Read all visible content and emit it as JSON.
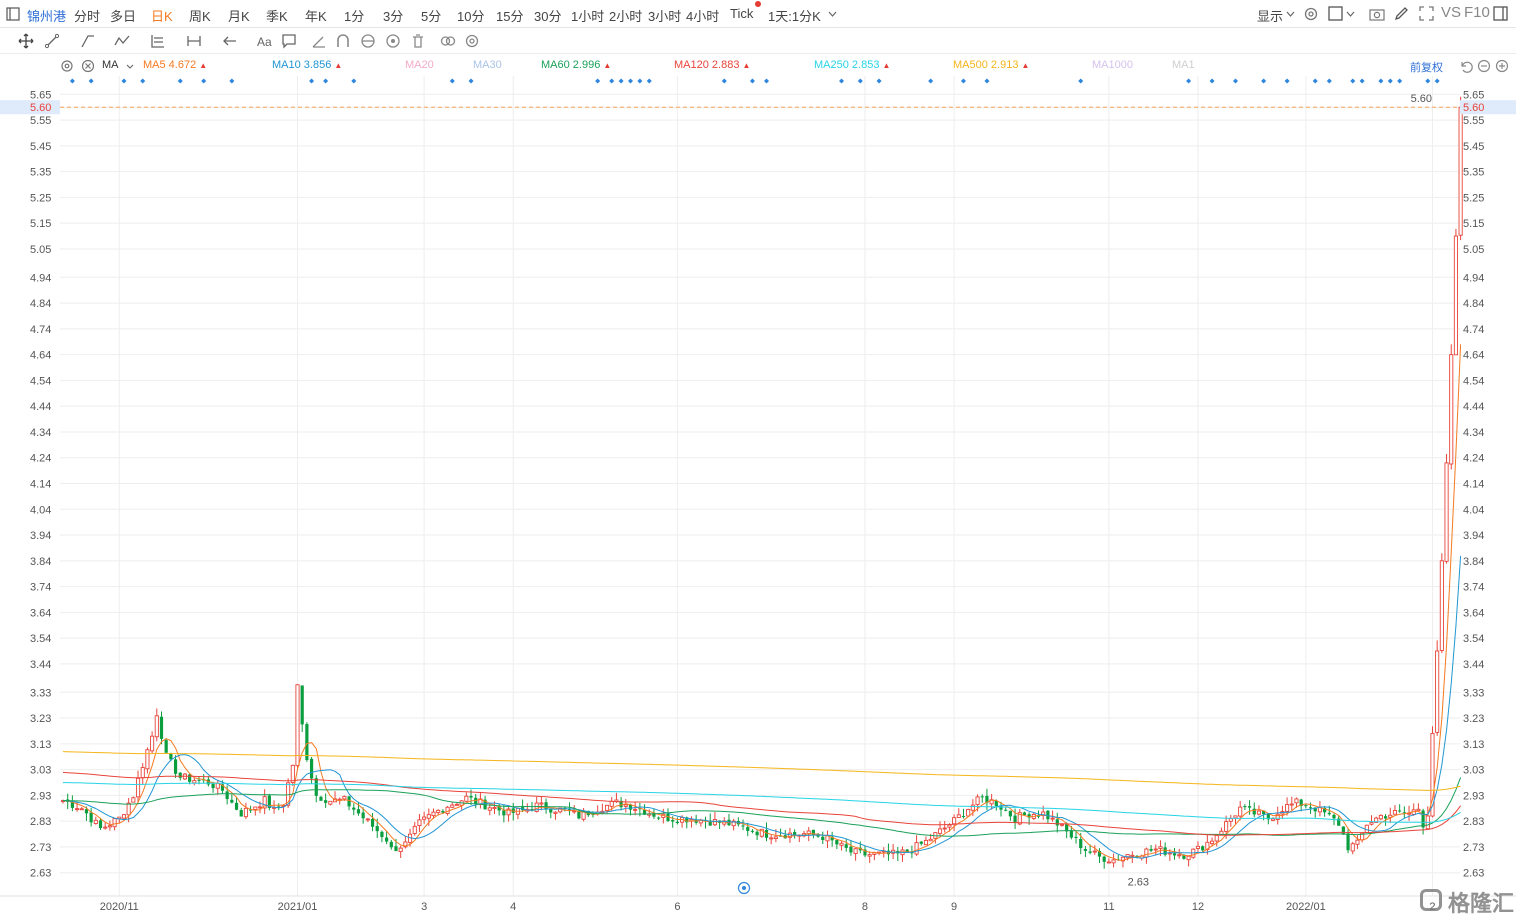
{
  "topbar": {
    "ticker": "锦州港",
    "periods": [
      "分时",
      "多日",
      "日K",
      "周K",
      "月K",
      "季K",
      "年K",
      "1分",
      "3分",
      "5分",
      "10分",
      "15分",
      "30分",
      "1小时",
      "2小时",
      "3小时",
      "4小时",
      "Tick"
    ],
    "active_period": "日K",
    "combo": "1天:1分K",
    "display_label": "显示",
    "vs_label": "VS",
    "f10_label": "F10"
  },
  "indicators": {
    "group_label": "MA",
    "items": [
      {
        "name": "MA5",
        "value": "4.672",
        "color": "#f57a20",
        "faded": false,
        "arrow": true
      },
      {
        "name": "MA10",
        "value": "3.856",
        "color": "#2196d3",
        "faded": false,
        "arrow": true
      },
      {
        "name": "MA20",
        "value": "",
        "color": "#f4aac8",
        "faded": true,
        "arrow": false
      },
      {
        "name": "MA30",
        "value": "",
        "color": "#a9c3e6",
        "faded": true,
        "arrow": false
      },
      {
        "name": "MA60",
        "value": "2.996",
        "color": "#1aa15a",
        "faded": false,
        "arrow": true
      },
      {
        "name": "MA120",
        "value": "2.883",
        "color": "#e8443a",
        "faded": false,
        "arrow": true
      },
      {
        "name": "MA250",
        "value": "2.853",
        "color": "#27d3e6",
        "faded": false,
        "arrow": true
      },
      {
        "name": "MA500",
        "value": "2.913",
        "color": "#f5b51a",
        "faded": false,
        "arrow": true
      },
      {
        "name": "MA1000",
        "value": "",
        "color": "#d4c2ee",
        "faded": true,
        "arrow": false
      },
      {
        "name": "MA1",
        "value": "",
        "color": "#cfcfcf",
        "faded": true,
        "arrow": false
      }
    ],
    "adjust_label": "前复权"
  },
  "colors": {
    "up": "#e8443a",
    "down": "#0b9e3f",
    "grid": "#eeeeee",
    "current_price": "#f5a35a"
  },
  "chart_data": {
    "type": "candlestick",
    "price_ticks": [
      "5.65",
      "5.60",
      "5.55",
      "5.45",
      "5.35",
      "5.25",
      "5.15",
      "5.05",
      "4.94",
      "4.84",
      "4.74",
      "4.64",
      "4.54",
      "4.44",
      "4.34",
      "4.24",
      "4.14",
      "4.04",
      "3.94",
      "3.84",
      "3.74",
      "3.64",
      "3.54",
      "3.44",
      "3.33",
      "3.23",
      "3.13",
      "3.03",
      "2.93",
      "2.83",
      "2.73",
      "2.63"
    ],
    "ylim": [
      2.59,
      5.69
    ],
    "current_price": "5.60",
    "high_label": "5.60",
    "low_label": "2.63",
    "x_ticks": [
      {
        "label": "2020/11",
        "index": 12
      },
      {
        "label": "2021/01",
        "index": 50
      },
      {
        "label": "3",
        "index": 77
      },
      {
        "label": "4",
        "index": 96
      },
      {
        "label": "6",
        "index": 131
      },
      {
        "label": "8",
        "index": 171
      },
      {
        "label": "9",
        "index": 190
      },
      {
        "label": "11",
        "index": 223
      },
      {
        "label": "12",
        "index": 242
      },
      {
        "label": "2022/01",
        "index": 265
      },
      {
        "label": "2",
        "index": 292
      }
    ],
    "anchors": [
      [
        0,
        2.91
      ],
      [
        4,
        2.88
      ],
      [
        8,
        2.8
      ],
      [
        12,
        2.84
      ],
      [
        15,
        2.93
      ],
      [
        17,
        3.05
      ],
      [
        19,
        3.16
      ],
      [
        20,
        3.25
      ],
      [
        22,
        3.08
      ],
      [
        25,
        3.0
      ],
      [
        28,
        2.99
      ],
      [
        31,
        2.98
      ],
      [
        34,
        2.95
      ],
      [
        36,
        2.9
      ],
      [
        38,
        2.86
      ],
      [
        41,
        2.89
      ],
      [
        43,
        2.91
      ],
      [
        45,
        2.87
      ],
      [
        47,
        2.9
      ],
      [
        49,
        3.05
      ],
      [
        50,
        3.35
      ],
      [
        51,
        3.2
      ],
      [
        52,
        3.08
      ],
      [
        54,
        2.93
      ],
      [
        57,
        2.91
      ],
      [
        60,
        2.91
      ],
      [
        63,
        2.86
      ],
      [
        66,
        2.81
      ],
      [
        69,
        2.76
      ],
      [
        70,
        2.72
      ],
      [
        73,
        2.74
      ],
      [
        76,
        2.82
      ],
      [
        79,
        2.86
      ],
      [
        82,
        2.89
      ],
      [
        86,
        2.92
      ],
      [
        89,
        2.9
      ],
      [
        92,
        2.88
      ],
      [
        95,
        2.86
      ],
      [
        98,
        2.87
      ],
      [
        101,
        2.89
      ],
      [
        104,
        2.88
      ],
      [
        107,
        2.87
      ],
      [
        110,
        2.85
      ],
      [
        114,
        2.88
      ],
      [
        118,
        2.9
      ],
      [
        121,
        2.89
      ],
      [
        124,
        2.87
      ],
      [
        127,
        2.85
      ],
      [
        130,
        2.84
      ],
      [
        134,
        2.84
      ],
      [
        138,
        2.83
      ],
      [
        142,
        2.82
      ],
      [
        146,
        2.8
      ],
      [
        150,
        2.78
      ],
      [
        154,
        2.78
      ],
      [
        158,
        2.78
      ],
      [
        162,
        2.77
      ],
      [
        166,
        2.73
      ],
      [
        168,
        2.71
      ],
      [
        171,
        2.7
      ],
      [
        175,
        2.7
      ],
      [
        178,
        2.7
      ],
      [
        181,
        2.72
      ],
      [
        184,
        2.75
      ],
      [
        187,
        2.79
      ],
      [
        190,
        2.83
      ],
      [
        193,
        2.88
      ],
      [
        196,
        2.92
      ],
      [
        199,
        2.9
      ],
      [
        201,
        2.87
      ],
      [
        203,
        2.84
      ],
      [
        206,
        2.86
      ],
      [
        209,
        2.86
      ],
      [
        212,
        2.82
      ],
      [
        215,
        2.77
      ],
      [
        218,
        2.72
      ],
      [
        221,
        2.69
      ],
      [
        224,
        2.68
      ],
      [
        227,
        2.7
      ],
      [
        230,
        2.71
      ],
      [
        233,
        2.72
      ],
      [
        236,
        2.71
      ],
      [
        239,
        2.7
      ],
      [
        242,
        2.72
      ],
      [
        245,
        2.76
      ],
      [
        248,
        2.82
      ],
      [
        251,
        2.88
      ],
      [
        254,
        2.86
      ],
      [
        257,
        2.84
      ],
      [
        260,
        2.88
      ],
      [
        263,
        2.9
      ],
      [
        266,
        2.89
      ],
      [
        269,
        2.86
      ],
      [
        272,
        2.82
      ],
      [
        274,
        2.73
      ],
      [
        276,
        2.74
      ],
      [
        278,
        2.82
      ],
      [
        281,
        2.85
      ],
      [
        284,
        2.86
      ],
      [
        287,
        2.86
      ],
      [
        289,
        2.88
      ],
      [
        290,
        2.82
      ],
      [
        291,
        2.85
      ],
      [
        292,
        3.17
      ],
      [
        293,
        3.49
      ],
      [
        294,
        3.84
      ],
      [
        295,
        4.22
      ],
      [
        296,
        4.64
      ],
      [
        297,
        5.1
      ],
      [
        298,
        5.6
      ]
    ],
    "ma_series": [
      {
        "name": "MA5",
        "color": "#f57a20",
        "window": 5
      },
      {
        "name": "MA10",
        "color": "#2196d3",
        "window": 10
      },
      {
        "name": "MA60",
        "color": "#1aa15a",
        "window": 60
      },
      {
        "name": "MA120",
        "color": "#e8443a",
        "window": 120
      },
      {
        "name": "MA250",
        "color": "#27d3e6",
        "window": 250
      },
      {
        "name": "MA500",
        "color": "#f5b51a",
        "window": 500
      }
    ]
  }
}
